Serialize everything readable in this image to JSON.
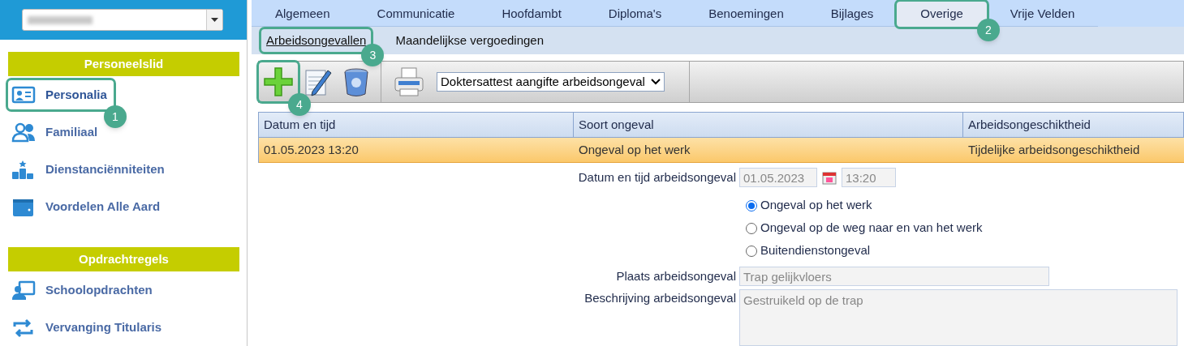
{
  "sidebar": {
    "sections": [
      {
        "title": "Personeelslid",
        "items": [
          {
            "label": "Personalia",
            "selected": true,
            "callout": "1"
          },
          {
            "label": "Familiaal",
            "selected": false
          },
          {
            "label": "Dienstanciënniteiten",
            "selected": false
          },
          {
            "label": "Voordelen Alle Aard",
            "selected": false
          }
        ]
      },
      {
        "title": "Opdrachtregels",
        "items": [
          {
            "label": "Schoolopdrachten",
            "selected": false
          },
          {
            "label": "Vervanging Titularis",
            "selected": false
          }
        ]
      }
    ]
  },
  "tabs": [
    {
      "label": "Algemeen",
      "selected": false
    },
    {
      "label": "Communicatie",
      "selected": false
    },
    {
      "label": "Hoofdambt",
      "selected": false
    },
    {
      "label": "Diploma's",
      "selected": false
    },
    {
      "label": "Benoemingen",
      "selected": false
    },
    {
      "label": "Bijlages",
      "selected": false
    },
    {
      "label": "Overige",
      "selected": true,
      "callout": "2"
    },
    {
      "label": "Vrije Velden",
      "selected": false
    }
  ],
  "subtabs": [
    {
      "label": "Arbeidsongevallen",
      "selected": true,
      "callout": "3"
    },
    {
      "label": "Maandelijkse vergoedingen",
      "selected": false
    }
  ],
  "toolbar": {
    "buttons": [
      {
        "kind": "add",
        "callout": "4"
      },
      {
        "kind": "edit"
      },
      {
        "kind": "delete"
      },
      {
        "kind": "print"
      }
    ],
    "report_select": "Doktersattest aangifte arbeidsongeval"
  },
  "table": {
    "columns": [
      "Datum en tijd",
      "Soort ongeval",
      "Arbeidsongeschiktheid"
    ],
    "rows": [
      {
        "cells": [
          "01.05.2023 13:20",
          "Ongeval op het werk",
          "Tijdelijke arbeidsongeschiktheid"
        ],
        "selected": true
      }
    ]
  },
  "form": {
    "datetime": {
      "label": "Datum en tijd arbeidsongeval",
      "date": "01.05.2023",
      "time": "13:20"
    },
    "accident_type": [
      {
        "label": "Ongeval op het werk",
        "selected": true
      },
      {
        "label": "Ongeval op de weg naar en van het werk",
        "selected": false
      },
      {
        "label": "Buitendienstongeval",
        "selected": false
      }
    ],
    "place": {
      "label": "Plaats arbeidsongeval",
      "value": "Trap gelijkvloers"
    },
    "description": {
      "label": "Beschrijving arbeidsongeval",
      "value": "Gestruikeld op de trap"
    }
  }
}
